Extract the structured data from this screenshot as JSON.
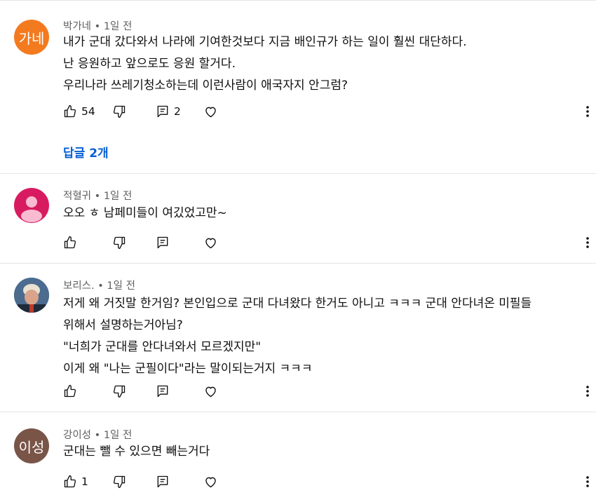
{
  "colors": {
    "avatar1": "#f47a1f",
    "avatar2": "#d81b60",
    "avatar4": "#795548",
    "link": "#065fd4"
  },
  "comments": [
    {
      "avatar_text": "가네",
      "author": "박가네",
      "time": "1일 전",
      "lines": [
        "내가 군대 갔다와서 나라에 기여한것보다 지금 배인규가 하는 일이 훨씬 대단하다.",
        "난 응원하고 앞으로도 응원 할거다.",
        "우리나라 쓰레기청소하는데 이런사람이 애국자지 안그럼?"
      ],
      "likes": "54",
      "reply_count": "2",
      "replies_link": "답글 2개"
    },
    {
      "avatar_text": "",
      "avatar_icon": "person-icon",
      "author": "적혈귀",
      "time": "1일 전",
      "lines": [
        "오오 ㅎ 남페미들이 여깄었고만~"
      ],
      "likes": "",
      "reply_count": ""
    },
    {
      "avatar_text": "",
      "avatar_icon": "photo-avatar",
      "author": "보리스.",
      "time": "1일 전",
      "lines": [
        "저게 왜 거짓말 한거임? 본인입으로 군대 다녀왔다 한거도 아니고 ㅋㅋㅋ 군대 안다녀온 미필들",
        "위해서 설명하는거아님?",
        "\"너희가 군대를 안다녀와서 모르겠지만\"",
        "이게 왜 \"나는 군필이다\"라는 말이되는거지 ㅋㅋㅋ"
      ],
      "likes": "",
      "reply_count": ""
    },
    {
      "avatar_text": "이성",
      "author": "강이성",
      "time": "1일 전",
      "lines": [
        "군대는 뺄 수 있으면 빼는거다"
      ],
      "likes": "1",
      "reply_count": ""
    }
  ]
}
